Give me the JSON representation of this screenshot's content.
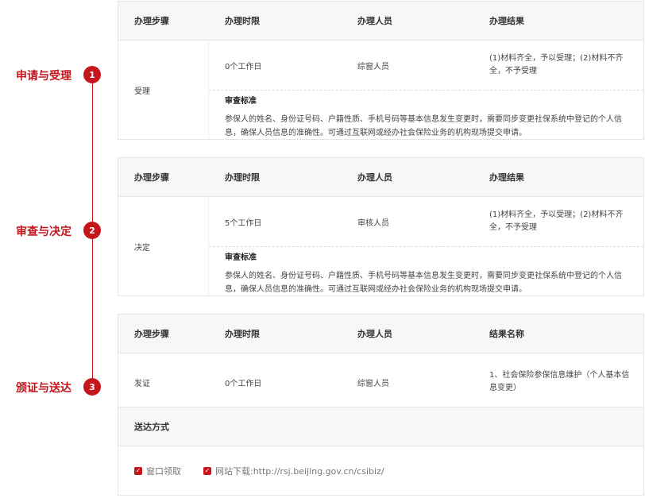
{
  "steps": [
    {
      "label": "申请与受理",
      "num": "1"
    },
    {
      "label": "审查与决定",
      "num": "2"
    },
    {
      "label": "颁证与送达",
      "num": "3"
    }
  ],
  "header": {
    "step": "办理步骤",
    "time": "办理时限",
    "person": "办理人员",
    "result": "办理结果",
    "result_name": "结果名称"
  },
  "block1": {
    "step": "受理",
    "time": "0个工作日",
    "person": "综窗人员",
    "result": "(1)材料齐全，予以受理；(2)材料不齐全，不予受理",
    "std_title": "审查标准",
    "std_text": "参保人的姓名、身份证号码、户籍性质、手机号码等基本信息发生变更时，需要同步变更社保系统中登记的个人信息，确保人员信息的准确性。可通过互联网或经办社会保险业务的机构现场提交申请。"
  },
  "block2": {
    "step": "决定",
    "time": "5个工作日",
    "person": "审核人员",
    "result": "(1)材料齐全，予以受理；(2)材料不齐全，不予受理",
    "std_title": "审查标准",
    "std_text": "参保人的姓名、身份证号码、户籍性质、手机号码等基本信息发生变更时，需要同步变更社保系统中登记的个人信息，确保人员信息的准确性。可通过互联网或经办社会保险业务的机构现场提交申请。"
  },
  "block3": {
    "step": "发证",
    "time": "0个工作日",
    "person": "综窗人员",
    "result": "1、社会保险参保信息维护（个人基本信息变更）"
  },
  "delivery": {
    "title": "送达方式",
    "options": [
      "窗口领取",
      "网站下载:http://rsj.beijing.gov.cn/csibiz/"
    ]
  },
  "colors": {
    "accent": "#c4161c"
  }
}
